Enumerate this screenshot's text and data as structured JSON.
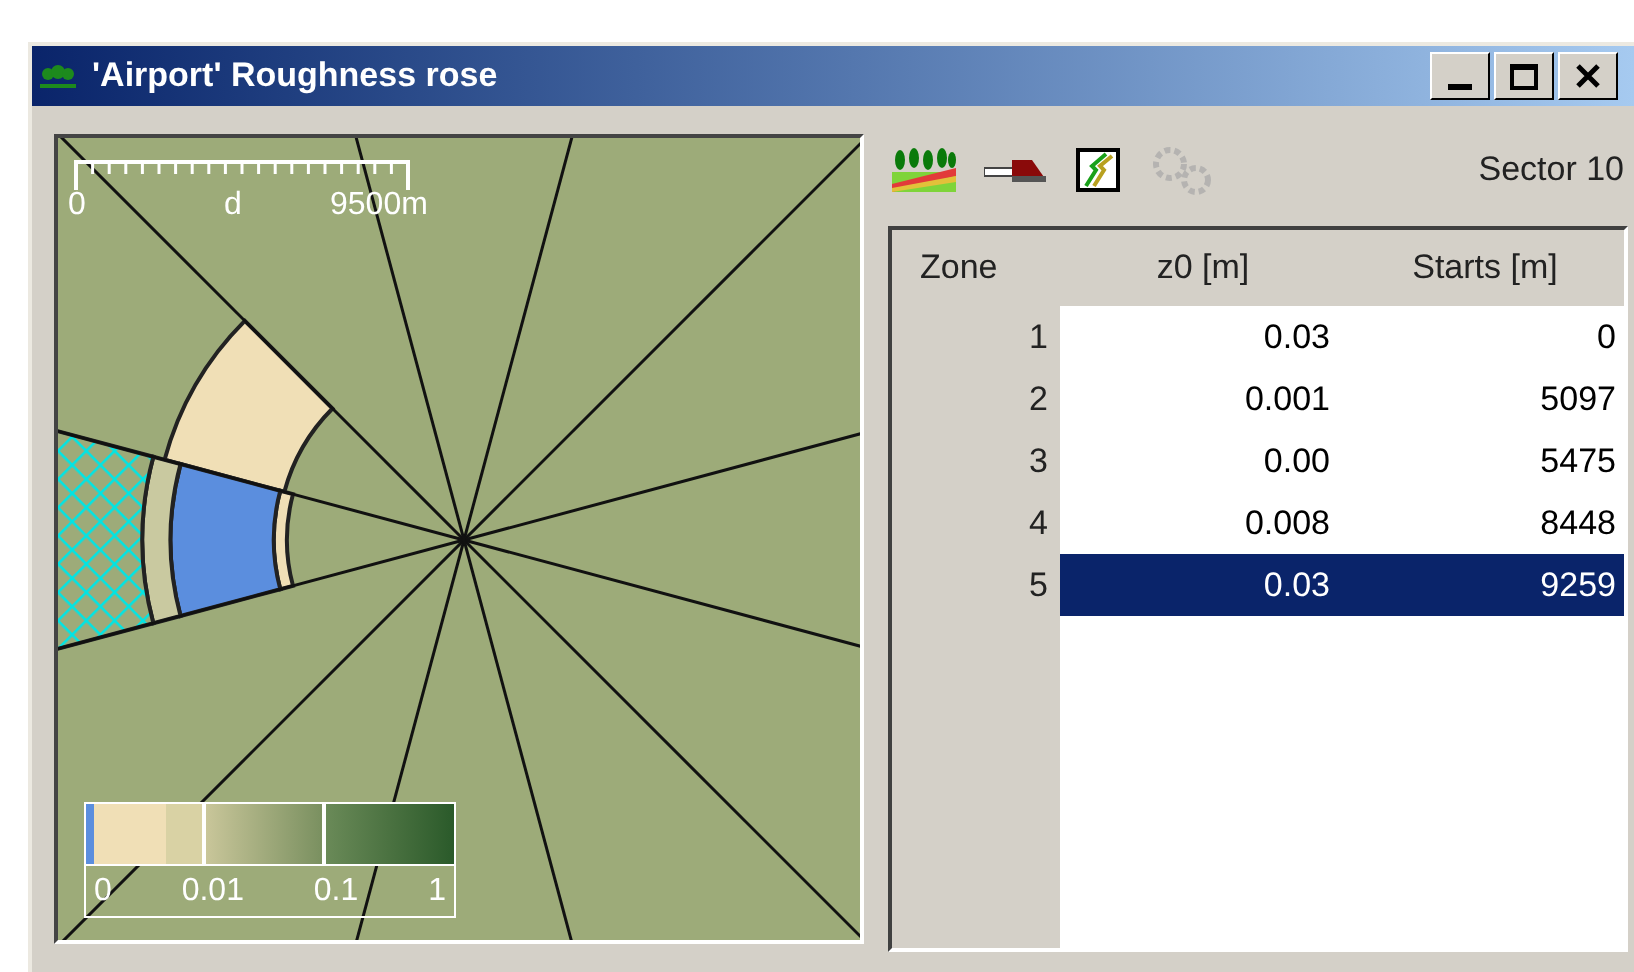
{
  "window": {
    "title": "'Airport' Roughness rose"
  },
  "map": {
    "scale_bar": {
      "start": "0",
      "middle": "d",
      "end": "9500m"
    },
    "legend": {
      "labels": [
        "0",
        "0.01",
        "0.1",
        "1"
      ]
    }
  },
  "toolbar": {
    "sector_label": "Sector 10",
    "tools": [
      {
        "kind": "roughness",
        "disabled": false
      },
      {
        "kind": "chainsaw",
        "disabled": false
      },
      {
        "kind": "edit",
        "disabled": false
      },
      {
        "kind": "gears",
        "disabled": true
      }
    ]
  },
  "table": {
    "columns": [
      "Zone",
      "z0 [m]",
      "Starts [m]"
    ],
    "rows": [
      {
        "zone": "1",
        "z0": "0.03",
        "starts": "0",
        "selected": false
      },
      {
        "zone": "2",
        "z0": "0.001",
        "starts": "5097",
        "selected": false
      },
      {
        "zone": "3",
        "z0": "0.00",
        "starts": "5475",
        "selected": false
      },
      {
        "zone": "4",
        "z0": "0.008",
        "starts": "8448",
        "selected": false
      },
      {
        "zone": "5",
        "z0": "0.03",
        "starts": "9259",
        "selected": true
      }
    ]
  }
}
